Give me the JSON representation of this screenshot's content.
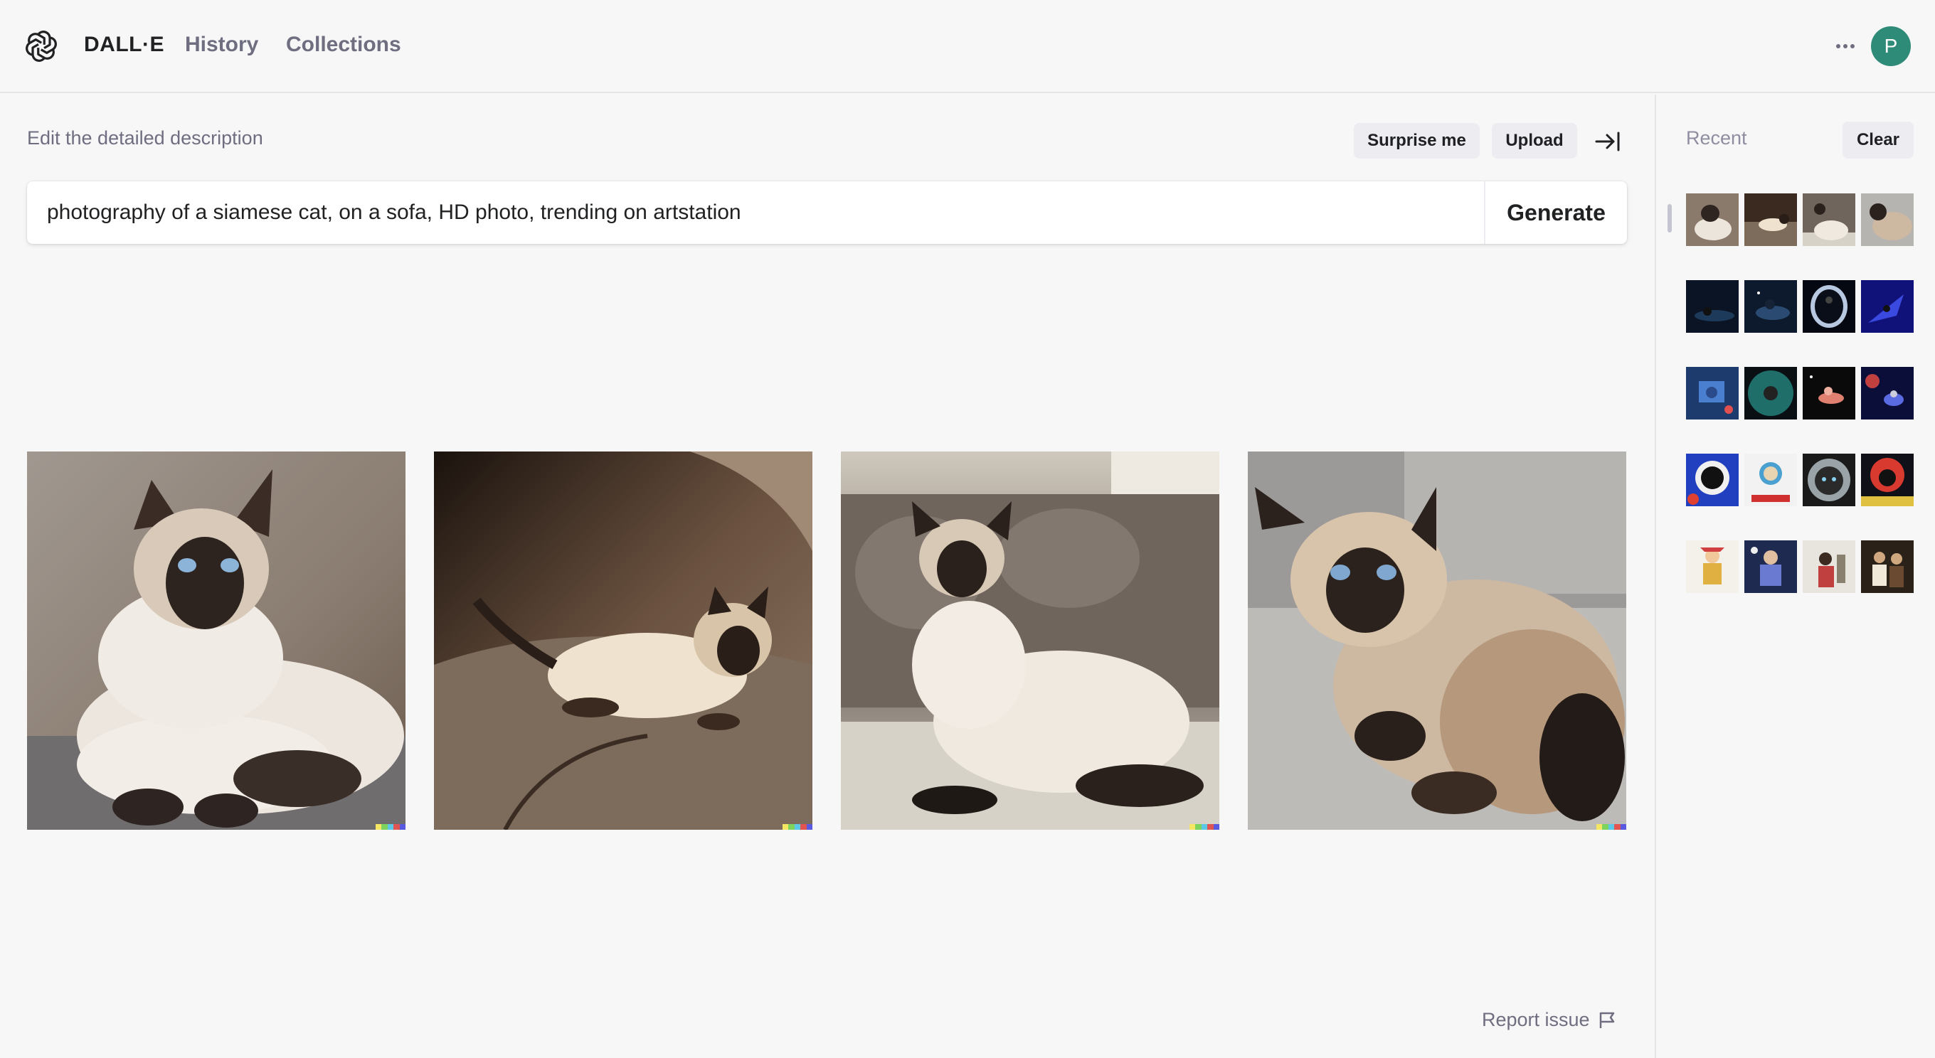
{
  "header": {
    "brand": "DALL·E",
    "nav": {
      "history": "History",
      "collections": "Collections"
    },
    "avatar_initial": "P",
    "avatar_color": "#2e8b78"
  },
  "editor": {
    "caption": "Edit the detailed description",
    "surprise_label": "Surprise me",
    "upload_label": "Upload",
    "prompt_value": "photography of a siamese cat, on a sofa, HD photo, trending on artstation",
    "generate_label": "Generate"
  },
  "results": [
    {
      "description": "siamese cat lying on grey blanket, facing camera"
    },
    {
      "description": "siamese cat lying on brown sofa in warm light"
    },
    {
      "description": "siamese cat sitting on grey sofa"
    },
    {
      "description": "siamese cat sprawled on grey blanket"
    }
  ],
  "report_issue": "Report issue",
  "sidebar": {
    "title": "Recent",
    "clear_label": "Clear",
    "rows": [
      [
        "siamese cat photo",
        "siamese cat photo",
        "siamese cat photo",
        "siamese cat photo"
      ],
      [
        "space cat",
        "space cat",
        "space cat",
        "space cat"
      ],
      [
        "space cat illustration",
        "space cat illustration",
        "space cat illustration",
        "space cat illustration"
      ],
      [
        "cat astronaut cartoon",
        "cat astronaut cartoon",
        "cat astronaut cartoon",
        "cat astronaut cartoon"
      ],
      [
        "people illustration",
        "people illustration",
        "people photo",
        "people photo"
      ]
    ]
  },
  "colors": {
    "background": "#f7f7f8",
    "text": "#202123",
    "muted": "#6e6e80",
    "chip": "#ececf1"
  }
}
